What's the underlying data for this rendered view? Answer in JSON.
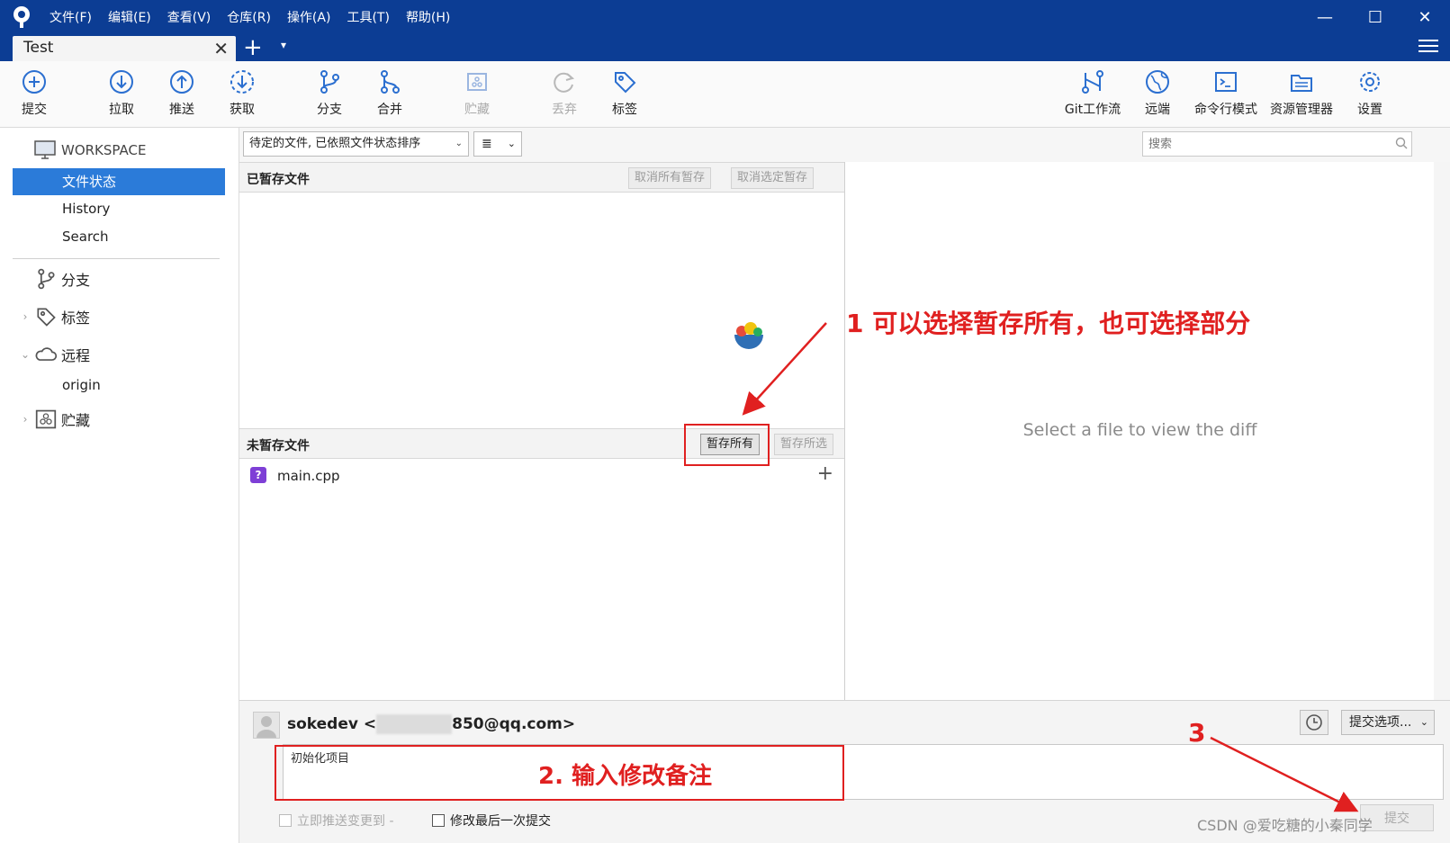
{
  "app": {
    "menu": [
      "文件(F)",
      "编辑(E)",
      "查看(V)",
      "仓库(R)",
      "操作(A)",
      "工具(T)",
      "帮助(H)"
    ],
    "tab_title": "Test",
    "window_controls": {
      "minimize": "—",
      "maximize": "☐",
      "close": "✕"
    },
    "tab_add": "+",
    "tab_dropdown": "▾"
  },
  "toolbar": {
    "commit": "提交",
    "pull": "拉取",
    "push": "推送",
    "fetch": "获取",
    "branch": "分支",
    "merge": "合并",
    "stash": "贮藏",
    "discard": "丢弃",
    "tag": "标签",
    "gitflow": "Git工作流",
    "remote": "远端",
    "terminal": "命令行模式",
    "explorer": "资源管理器",
    "settings": "设置"
  },
  "sidebar": {
    "workspace": "WORKSPACE",
    "items": [
      "文件状态",
      "History",
      "Search"
    ],
    "active_index": 0,
    "groups": {
      "branches": "分支",
      "tags": "标签",
      "remotes": "远程",
      "remote_origin": "origin",
      "stashes": "贮藏"
    }
  },
  "filter": {
    "mode": "待定的文件, 已依照文件状态排序",
    "view_icon": "≣",
    "search_placeholder": "搜索"
  },
  "staged": {
    "title": "已暂存文件",
    "unstage_all": "取消所有暂存",
    "unstage_selected": "取消选定暂存"
  },
  "unstaged": {
    "title": "未暂存文件",
    "stage_all": "暂存所有",
    "stage_selected": "暂存所选",
    "files": [
      {
        "badge": "?",
        "name": "main.cpp",
        "status_color": "#7e3fd6"
      }
    ]
  },
  "diff": {
    "placeholder": "Select a file to view the diff"
  },
  "commit": {
    "author_name": "sokedev",
    "author_email_prefix": "<",
    "author_email_suffix": "850@qq.com>",
    "options": "提交选项...",
    "message": "初始化项目",
    "push_immediately": "立即推送变更到 -",
    "amend": "修改最后一次提交",
    "commit_button": "提交"
  },
  "annotations": {
    "step1": "1  可以选择暂存所有，也可选择部分",
    "step2": "2.  输入修改备注",
    "step3": "3"
  },
  "watermark": "CSDN @爱吃糖的小秦同学",
  "colors": {
    "titlebar": "#0c3d94",
    "active_item": "#2b7bd9",
    "annotation_red": "#e02020"
  }
}
